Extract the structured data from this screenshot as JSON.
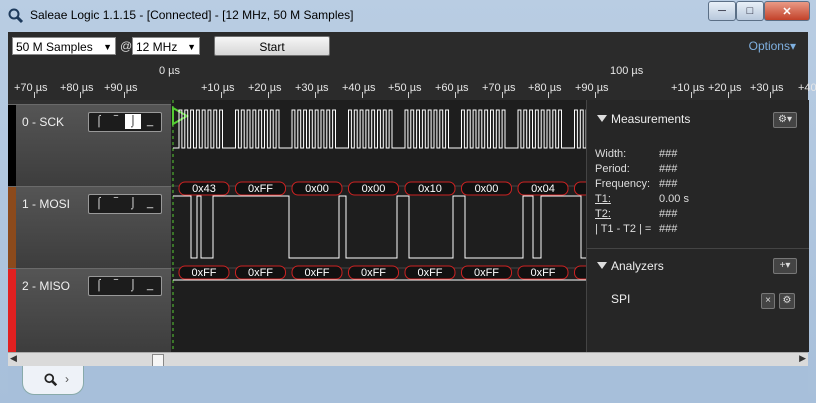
{
  "window": {
    "title": "Saleae Logic 1.1.15 - [Connected] - [12 MHz, 50 M Samples]",
    "minimize_label": "─",
    "maximize_label": "□",
    "close_label": "✕"
  },
  "toolbar": {
    "samples": "50 M Samples",
    "at": "@",
    "rate": "12 MHz",
    "start_label": "Start",
    "options_label": "Options▾"
  },
  "ruler": {
    "zero_label": "0 µs",
    "hundred_label": "100 µs",
    "ticks": [
      "+70 µs",
      "+80 µs",
      "+90 µs",
      "+10 µs",
      "+20 µs",
      "+30 µs",
      "+40 µs",
      "+50 µs",
      "+60 µs",
      "+70 µs",
      "+80 µs",
      "+90 µs",
      "+10 µs",
      "+20 µs",
      "+30 µs",
      "+40 µs"
    ]
  },
  "channels": [
    {
      "label": "0 - SCK",
      "color": "#000000"
    },
    {
      "label": "1 - MOSI",
      "color": "#8b4a1c"
    },
    {
      "label": "2 - MISO",
      "color": "#e02020"
    }
  ],
  "mosi_bytes": [
    "0x43",
    "0xFF",
    "0x00",
    "0x00",
    "0x10",
    "0x00",
    "0x04",
    "0x"
  ],
  "miso_bytes": [
    "0xFF",
    "0xFF",
    "0xFF",
    "0xFF",
    "0xFF",
    "0xFF",
    "0xFF",
    "0x"
  ],
  "measurements": {
    "title": "Measurements",
    "rows": [
      {
        "label": "Width:",
        "value": "###"
      },
      {
        "label": "Period:",
        "value": "###"
      },
      {
        "label": "Frequency:",
        "value": "###"
      },
      {
        "label": "T1:",
        "value": "0.00 s"
      },
      {
        "label": "T2:",
        "value": "###"
      },
      {
        "label": "| T1 - T2 | =",
        "value": "###"
      }
    ]
  },
  "analyzers": {
    "title": "Analyzers",
    "items": [
      "SPI"
    ]
  },
  "colors": {
    "accent": "#7fb0e0",
    "trigger": "#55cc33",
    "bubble_border": "#cc2222"
  }
}
